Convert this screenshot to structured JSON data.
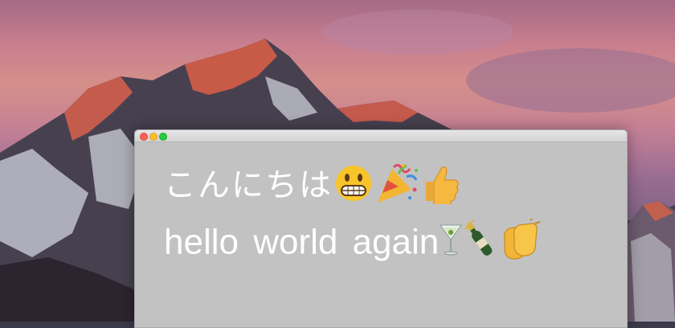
{
  "window": {
    "traffic_lights": {
      "close_color": "#fc5f57",
      "minimize_color": "#fdbc2e",
      "zoom_color": "#2ac940"
    },
    "background_color": "#c2c2c2"
  },
  "content": {
    "line1": {
      "text": "こんにちは",
      "emojis": [
        "grinning-face-emoji",
        "party-popper-emoji",
        "thumbs-up-emoji"
      ]
    },
    "line2": {
      "text": "hello  world  again",
      "emojis": [
        "cocktail-glass-emoji",
        "champagne-bottle-emoji",
        "clapping-hands-emoji"
      ]
    }
  }
}
